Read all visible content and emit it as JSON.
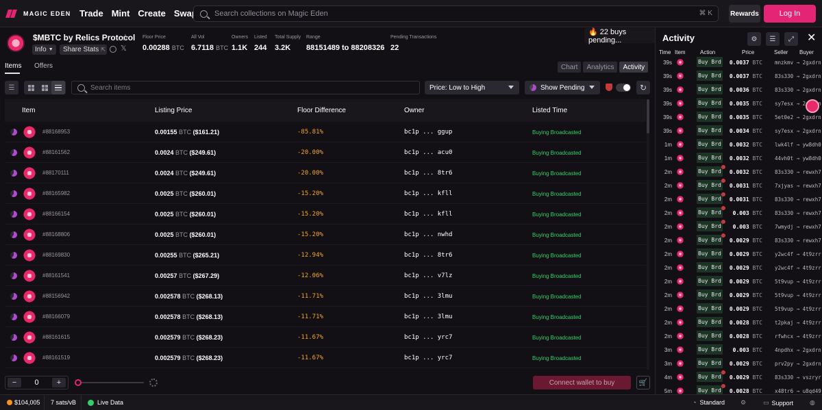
{
  "nav": {
    "logo": "MAGIC EDEN",
    "links": [
      "Trade",
      "Mint",
      "Create",
      "Swap"
    ],
    "search_placeholder": "Search collections on Magic Eden",
    "search_shortcut": "⌘ K",
    "rewards": "Rewards",
    "login": "Log In"
  },
  "collection": {
    "name": "$MBTC by Relics Protocol",
    "info": "Info",
    "share": "Share Stats",
    "stats": [
      {
        "label": "Floor Price",
        "value": "0.00288",
        "unit": "BTC"
      },
      {
        "label": "All Vol",
        "value": "6.7118",
        "unit": "BTC"
      },
      {
        "label": "Owners",
        "value": "1.1K",
        "unit": ""
      },
      {
        "label": "Listed",
        "value": "244",
        "unit": ""
      },
      {
        "label": "Total Supply",
        "value": "3.2K",
        "unit": ""
      },
      {
        "label": "Range",
        "value": "88151489 to 88208326",
        "unit": ""
      },
      {
        "label": "Pending Transactions",
        "value": "22",
        "unit": ""
      }
    ],
    "pending_pill": "🔥 22 buys pending..."
  },
  "tabs": {
    "items": "Items",
    "offers": "Offers",
    "views": [
      "Chart",
      "Analytics",
      "Activity"
    ]
  },
  "toolbar": {
    "search_placeholder": "Search items",
    "sort": "Price: Low to High",
    "pending": "Show Pending"
  },
  "table": {
    "headers": [
      "Item",
      "Listing Price",
      "Floor Difference",
      "Owner",
      "Listed Time"
    ],
    "rows": [
      {
        "id": "#88168953",
        "price": "0.00155",
        "usd": "($161.21)",
        "fd": "-85.81%",
        "owner": "bc1p ... ggup",
        "time": "Buying Broadcasted"
      },
      {
        "id": "#88161562",
        "price": "0.0024",
        "usd": "($249.61)",
        "fd": "-20.00%",
        "owner": "bc1p ... acu0",
        "time": "Buying Broadcasted"
      },
      {
        "id": "#88170111",
        "price": "0.0024",
        "usd": "($249.61)",
        "fd": "-20.00%",
        "owner": "bc1p ... 8tr6",
        "time": "Buying Broadcasted"
      },
      {
        "id": "#88165982",
        "price": "0.0025",
        "usd": "($260.01)",
        "fd": "-15.20%",
        "owner": "bc1p ... kfll",
        "time": "Buying Broadcasted"
      },
      {
        "id": "#88166154",
        "price": "0.0025",
        "usd": "($260.01)",
        "fd": "-15.20%",
        "owner": "bc1p ... kfll",
        "time": "Buying Broadcasted"
      },
      {
        "id": "#88168806",
        "price": "0.0025",
        "usd": "($260.01)",
        "fd": "-15.20%",
        "owner": "bc1p ... nwhd",
        "time": "Buying Broadcasted"
      },
      {
        "id": "#88169830",
        "price": "0.00255",
        "usd": "($265.21)",
        "fd": "-12.94%",
        "owner": "bc1p ... 8tr6",
        "time": "Buying Broadcasted"
      },
      {
        "id": "#88161541",
        "price": "0.00257",
        "usd": "($267.29)",
        "fd": "-12.06%",
        "owner": "bc1p ... v7lz",
        "time": "Buying Broadcasted"
      },
      {
        "id": "#88156942",
        "price": "0.002578",
        "usd": "($268.13)",
        "fd": "-11.71%",
        "owner": "bc1p ... 3lmu",
        "time": "Buying Broadcasted"
      },
      {
        "id": "#88166079",
        "price": "0.002578",
        "usd": "($268.13)",
        "fd": "-11.71%",
        "owner": "bc1p ... 3lmu",
        "time": "Buying Broadcasted"
      },
      {
        "id": "#88161615",
        "price": "0.002579",
        "usd": "($268.23)",
        "fd": "-11.67%",
        "owner": "bc1p ... yrc7",
        "time": "Buying Broadcasted"
      },
      {
        "id": "#88161519",
        "price": "0.002579",
        "usd": "($268.23)",
        "fd": "-11.67%",
        "owner": "bc1p ... yrc7",
        "time": "Buying Broadcasted"
      }
    ],
    "unit": "BTC"
  },
  "bottom": {
    "qty": "0",
    "minus": "−",
    "plus": "+",
    "connect": "Connect wallet to buy"
  },
  "status": {
    "btc": "$104,005",
    "fee": "7 sats/vB",
    "live": "Live Data",
    "standard": "Standard",
    "support": "Support"
  },
  "activity": {
    "title": "Activity",
    "headers": [
      "Time",
      "Item",
      "Action",
      "Price",
      "Seller",
      "Buyer"
    ],
    "unit": "BTC",
    "rows": [
      {
        "t": "39s",
        "a": "Buy Brd",
        "p": "0.0037",
        "s": "mnzkmv",
        "b": "2gxdrn",
        "flag": false
      },
      {
        "t": "39s",
        "a": "Buy Brd",
        "p": "0.0037",
        "s": "83s330",
        "b": "2gxdrn",
        "flag": false
      },
      {
        "t": "39s",
        "a": "Buy Brd",
        "p": "0.0036",
        "s": "83s330",
        "b": "2gxdrn",
        "flag": false
      },
      {
        "t": "39s",
        "a": "Buy Brd",
        "p": "0.0035",
        "s": "sy7esx",
        "b": "2gxdrn",
        "flag": false
      },
      {
        "t": "39s",
        "a": "Buy Brd",
        "p": "0.0035",
        "s": "5et0e2",
        "b": "2gxdrn",
        "flag": false
      },
      {
        "t": "39s",
        "a": "Buy Brd",
        "p": "0.0034",
        "s": "sy7esx",
        "b": "2gxdrn",
        "flag": false
      },
      {
        "t": "1m",
        "a": "Buy Brd",
        "p": "0.0032",
        "s": "lwk4lf",
        "b": "yw8dh0",
        "flag": false
      },
      {
        "t": "1m",
        "a": "Buy Brd",
        "p": "0.0032",
        "s": "44vh0t",
        "b": "yw8dh0",
        "flag": false
      },
      {
        "t": "2m",
        "a": "Buy Brd",
        "p": "0.0032",
        "s": "83s330",
        "b": "rewxh7",
        "flag": true
      },
      {
        "t": "2m",
        "a": "Buy Brd",
        "p": "0.0031",
        "s": "7xjyas",
        "b": "rewxh7",
        "flag": true
      },
      {
        "t": "2m",
        "a": "Buy Brd",
        "p": "0.0031",
        "s": "83s330",
        "b": "rewxh7",
        "flag": true
      },
      {
        "t": "2m",
        "a": "Buy Brd",
        "p": "0.003",
        "s": "83s330",
        "b": "rewxh7",
        "flag": true
      },
      {
        "t": "2m",
        "a": "Buy Brd",
        "p": "0.003",
        "s": "7wmydj",
        "b": "rewxh7",
        "flag": true
      },
      {
        "t": "2m",
        "a": "Buy Brd",
        "p": "0.0029",
        "s": "83s330",
        "b": "rewxh7",
        "flag": true
      },
      {
        "t": "2m",
        "a": "Buy Brd",
        "p": "0.0029",
        "s": "y2wc4f",
        "b": "4t9zrr",
        "flag": false
      },
      {
        "t": "2m",
        "a": "Buy Brd",
        "p": "0.0029",
        "s": "y2wc4f",
        "b": "4t9zrr",
        "flag": false
      },
      {
        "t": "2m",
        "a": "Buy Brd",
        "p": "0.0029",
        "s": "5t9vup",
        "b": "4t9zrr",
        "flag": false
      },
      {
        "t": "2m",
        "a": "Buy Brd",
        "p": "0.0029",
        "s": "5t9vup",
        "b": "4t9zrr",
        "flag": false
      },
      {
        "t": "2m",
        "a": "Buy Brd",
        "p": "0.0029",
        "s": "5t9vup",
        "b": "4t9zrr",
        "flag": false
      },
      {
        "t": "2m",
        "a": "Buy Brd",
        "p": "0.0028",
        "s": "t2pkaj",
        "b": "4t9zrr",
        "flag": false
      },
      {
        "t": "2m",
        "a": "Buy Brd",
        "p": "0.0028",
        "s": "rfwhcx",
        "b": "4t9zrr",
        "flag": false
      },
      {
        "t": "3m",
        "a": "Buy Brd",
        "p": "0.003",
        "s": "4npdhx",
        "b": "2gxdrn",
        "flag": false
      },
      {
        "t": "3m",
        "a": "Buy Brd",
        "p": "0.0029",
        "s": "prv2py",
        "b": "2gxdrn",
        "flag": false
      },
      {
        "t": "4m",
        "a": "Buy Brd",
        "p": "0.0029",
        "s": "83s330",
        "b": "vszryr",
        "flag": true
      },
      {
        "t": "5m",
        "a": "Buy Brd",
        "p": "0.0028",
        "s": "x48tr6",
        "b": "u8qd49",
        "flag": true
      }
    ]
  }
}
